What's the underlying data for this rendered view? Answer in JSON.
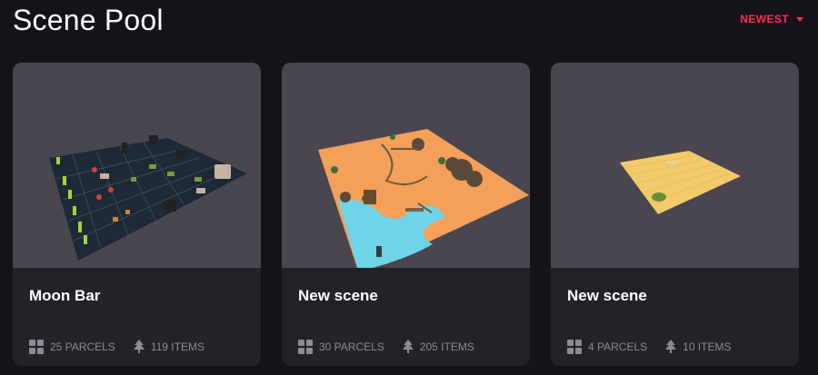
{
  "page": {
    "title": "Scene Pool"
  },
  "sort": {
    "label": "NEWEST",
    "color": "#ff2d55"
  },
  "cards": [
    {
      "title": "Moon Bar",
      "parcels": "25 PARCELS",
      "items": "119 ITEMS"
    },
    {
      "title": "New scene",
      "parcels": "30 PARCELS",
      "items": "205 ITEMS"
    },
    {
      "title": "New scene",
      "parcels": "4 PARCELS",
      "items": "10 ITEMS"
    }
  ],
  "icons": {
    "parcels": "grid-icon",
    "items": "tree-icon",
    "sort": "caret-down-icon"
  }
}
